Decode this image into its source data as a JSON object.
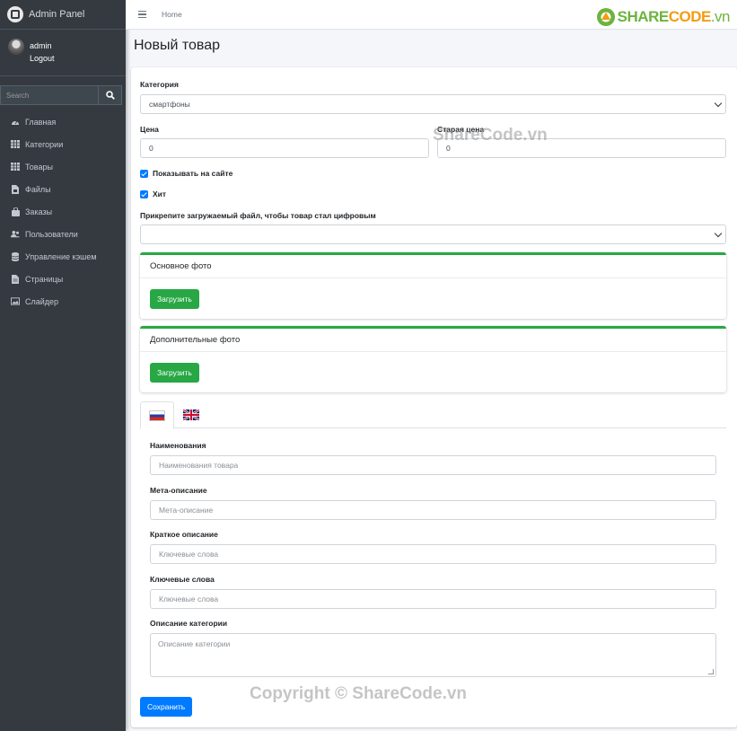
{
  "sidebar": {
    "brand": "Admin Panel",
    "user": {
      "name": "admin",
      "logout": "Logout"
    },
    "search_placeholder": "Search",
    "items": [
      {
        "label": "Главная",
        "icon": "dashboard-icon"
      },
      {
        "label": "Категории",
        "icon": "grid-icon"
      },
      {
        "label": "Товары",
        "icon": "grid-icon"
      },
      {
        "label": "Файлы",
        "icon": "file-icon"
      },
      {
        "label": "Заказы",
        "icon": "shopping-bag-icon"
      },
      {
        "label": "Пользователи",
        "icon": "users-icon"
      },
      {
        "label": "Управление кэшем",
        "icon": "database-icon"
      },
      {
        "label": "Страницы",
        "icon": "page-icon"
      },
      {
        "label": "Слайдер",
        "icon": "image-icon"
      }
    ]
  },
  "topbar": {
    "home": "Home",
    "logo_part1": "SHARE",
    "logo_part2": "CODE",
    "logo_part3": ".vn"
  },
  "page": {
    "title": "Новый товар"
  },
  "form": {
    "category_label": "Категория",
    "category_value": "смартфоны",
    "price_label": "Цена",
    "price_value": "0",
    "old_price_label": "Старая цена",
    "old_price_value": "0",
    "show_on_site": "Показывать на сайте",
    "hit": "Хит",
    "digital_file_label": "Прикрепите загружаемый файл, чтобы товар стал цифровым",
    "digital_file_value": "",
    "main_photo_title": "Основное фото",
    "extra_photo_title": "Дополнительные фото",
    "upload": "Загрузить",
    "name_label": "Наименования",
    "name_placeholder": "Наименования товара",
    "meta_label": "Мета-описание",
    "meta_placeholder": "Мета-описание",
    "short_desc_label": "Краткое описание",
    "short_desc_placeholder": "Ключевые слова",
    "keywords_label": "Ключевые слова",
    "keywords_placeholder": "Ключевые слова",
    "category_desc_label": "Описание категории",
    "category_desc_placeholder": "Описание категории",
    "save": "Сохранить"
  },
  "watermarks": {
    "center": "ShareCode.vn",
    "footer": "Copyright © ShareCode.vn"
  },
  "colors": {
    "sidebar_bg": "#343a40",
    "accent_green": "#28a745",
    "accent_blue": "#007bff"
  }
}
